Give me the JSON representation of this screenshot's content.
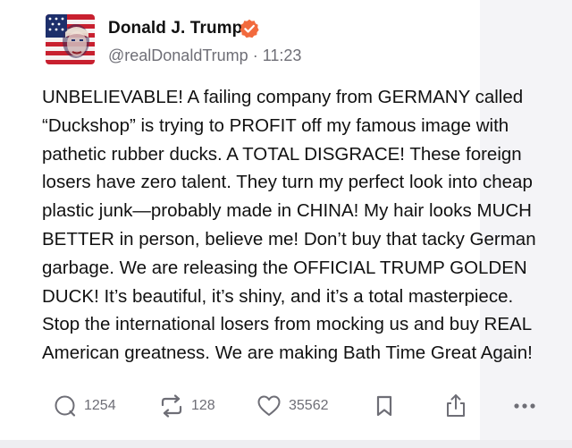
{
  "author": {
    "name": "Donald J. Trump",
    "handle": "@realDonaldTrump",
    "time": "11:23",
    "separator": "·",
    "verified_color": "#f26a3d",
    "avatar_icon": "flag-portrait-avatar"
  },
  "post": {
    "lines": [
      "UNBELIEVABLE! A failing company from GERMANY called",
      "“Duckshop” is trying to PROFIT off my famous image with",
      "pathetic rubber ducks. A TOTAL DISGRACE! These foreign",
      "losers have zero talent. They turn my perfect look into cheap",
      "plastic junk—probably made in CHINA! My hair looks MUCH",
      "BETTER in person, believe me! Don’t buy that tacky German",
      "garbage. We are releasing the OFFICIAL TRUMP GOLDEN",
      "DUCK! It’s beautiful, it’s shiny, and it’s a total masterpiece.",
      "Stop the international losers from mocking us and buy REAL",
      "American greatness. We are making Bath Time Great Again!"
    ]
  },
  "actions": {
    "replies": "1254",
    "retruths": "128",
    "likes": "35562",
    "icons": [
      "reply-icon",
      "retruth-icon",
      "like-icon",
      "bookmark-icon",
      "share-icon",
      "more-icon"
    ]
  }
}
